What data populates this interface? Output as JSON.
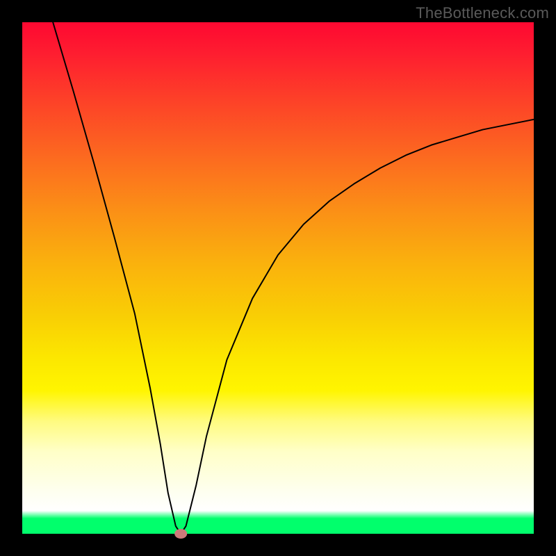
{
  "watermark": "TheBottleneck.com",
  "chart_data": {
    "type": "line",
    "title": "",
    "xlabel": "",
    "ylabel": "",
    "xlim": [
      0,
      100
    ],
    "ylim": [
      0,
      100
    ],
    "grid": false,
    "legend": false,
    "series": [
      {
        "name": "bottleneck-curve",
        "x": [
          6,
          10,
          14,
          18,
          22,
          25,
          27,
          28.5,
          30,
          31,
          32,
          34,
          36,
          40,
          45,
          50,
          55,
          60,
          65,
          70,
          75,
          80,
          85,
          90,
          95,
          100
        ],
        "y": [
          100,
          86.5,
          72.5,
          58,
          43,
          28.5,
          17.5,
          8,
          1.5,
          0,
          1.5,
          9.5,
          19,
          34,
          46,
          54.5,
          60.5,
          65,
          68.5,
          71.5,
          74,
          76,
          77.5,
          79,
          80,
          81
        ]
      }
    ],
    "marker": {
      "x": 31,
      "y": 0,
      "color": "#cc7a7a"
    }
  },
  "colors": {
    "background": "#000000",
    "gradient_top": "#fe0831",
    "gradient_bottom": "#01ff6c",
    "curve": "#000000",
    "marker": "#cc7a7a"
  }
}
